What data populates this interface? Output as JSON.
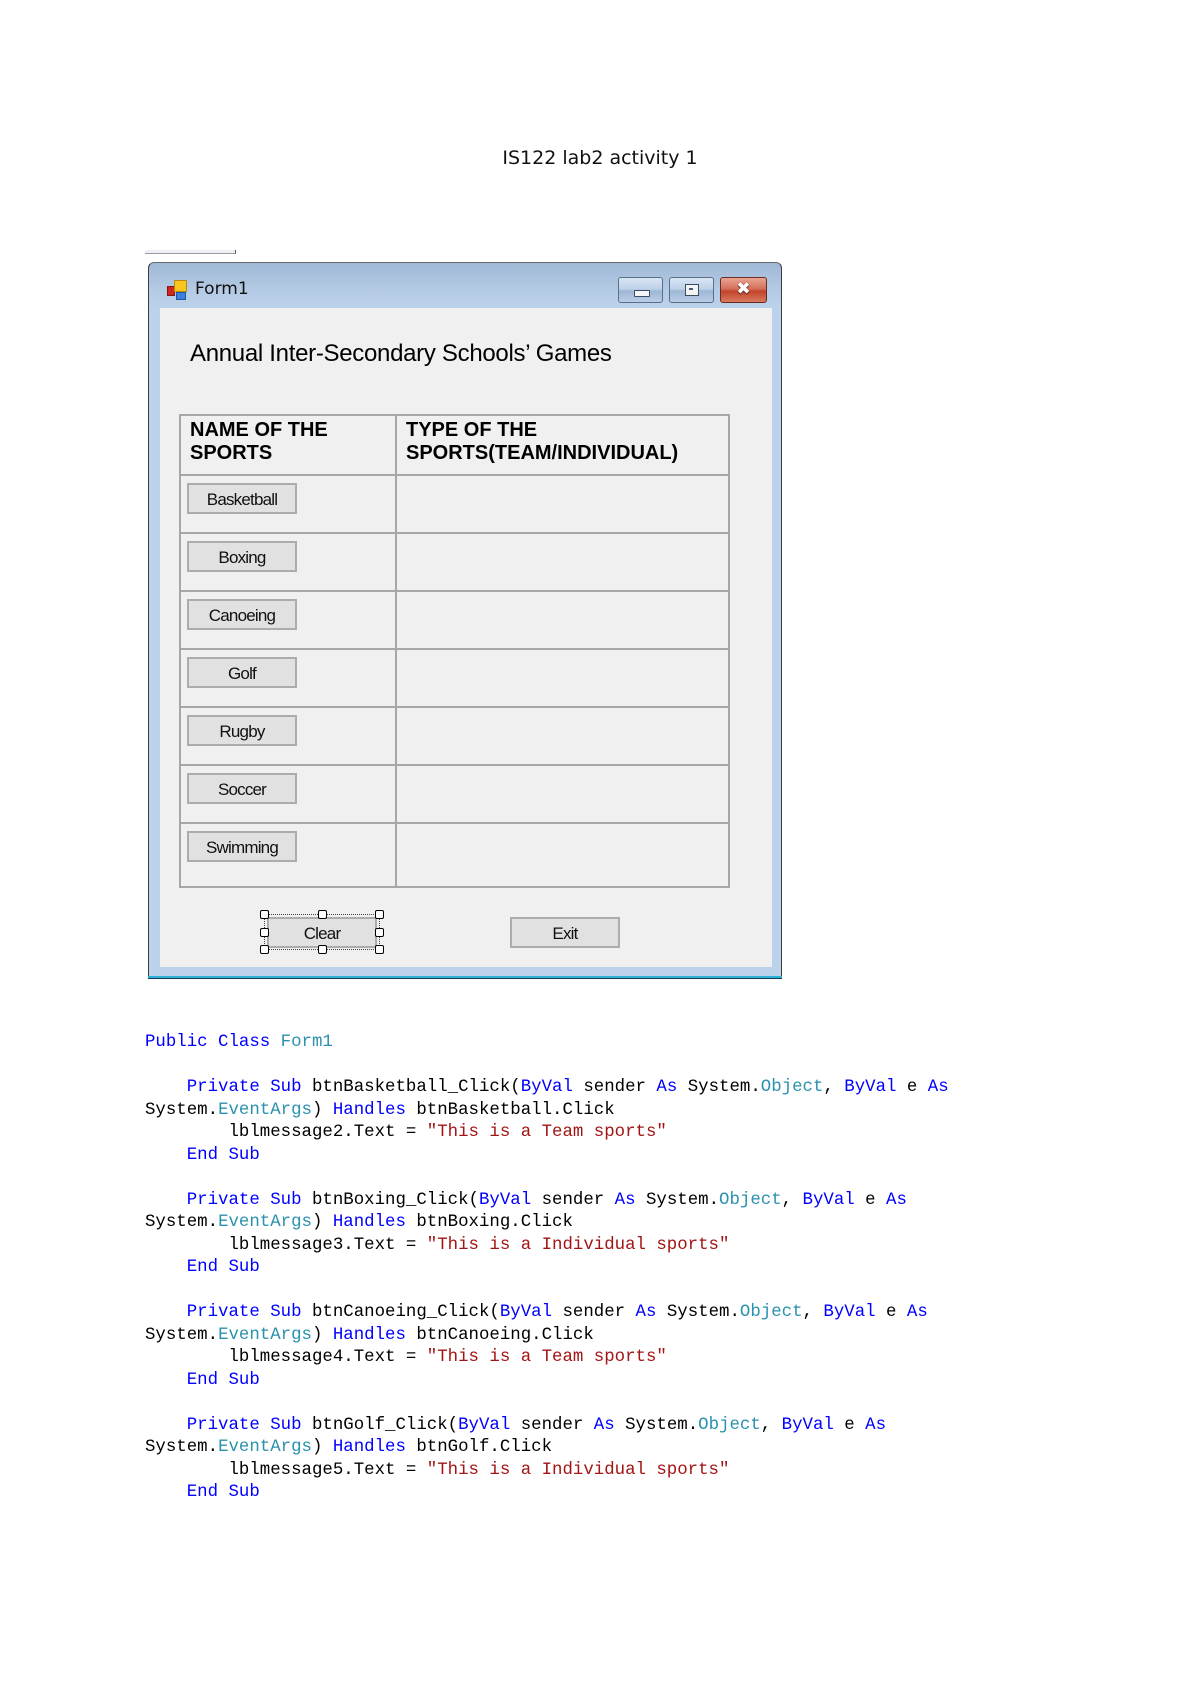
{
  "document": {
    "title": "IS122 lab2 activity 1"
  },
  "window": {
    "title": "Form1",
    "icon": "winforms-app-icon",
    "controls": {
      "minimize": "minimize-icon",
      "maximize": "maximize-icon",
      "close": "close-icon",
      "close_glyph": "✖"
    }
  },
  "form": {
    "heading": "Annual Inter-Secondary Schools’ Games",
    "table": {
      "headers": [
        "NAME OF THE SPORTS",
        "TYPE OF THE SPORTS(TEAM/INDIVIDUAL)"
      ],
      "rows": [
        {
          "sport": "Basketball",
          "type": ""
        },
        {
          "sport": "Boxing",
          "type": ""
        },
        {
          "sport": "Canoeing",
          "type": ""
        },
        {
          "sport": "Golf",
          "type": ""
        },
        {
          "sport": "Rugby",
          "type": ""
        },
        {
          "sport": "Soccer",
          "type": ""
        },
        {
          "sport": "Swimming",
          "type": ""
        }
      ]
    },
    "clear_label": "Clear",
    "exit_label": "Exit",
    "selected_control": "Clear"
  },
  "code": {
    "colors": {
      "keyword": "#0000ff",
      "type": "#2b91af",
      "string": "#a31515",
      "plain": "#000000"
    },
    "lines": [
      [
        [
          "kw",
          "Public Class "
        ],
        [
          "ty",
          "Form1"
        ]
      ],
      [],
      [
        [
          "",
          "    "
        ],
        [
          "kw",
          "Private Sub"
        ],
        [
          "",
          " btnBasketball_Click("
        ],
        [
          "kw",
          "ByVal"
        ],
        [
          "",
          " sender "
        ],
        [
          "kw",
          "As"
        ],
        [
          "",
          " System."
        ],
        [
          "ty",
          "Object"
        ],
        [
          "",
          ", "
        ],
        [
          "kw",
          "ByVal"
        ],
        [
          "",
          " e "
        ],
        [
          "kw",
          "As"
        ]
      ],
      [
        [
          "",
          "System."
        ],
        [
          "ty",
          "EventArgs"
        ],
        [
          "",
          ") "
        ],
        [
          "kw",
          "Handles"
        ],
        [
          "",
          " btnBasketball.Click"
        ]
      ],
      [
        [
          "",
          "        lblmessage2.Text = "
        ],
        [
          "str",
          "\"This is a Team sports\""
        ]
      ],
      [
        [
          "",
          "    "
        ],
        [
          "kw",
          "End Sub"
        ]
      ],
      [],
      [
        [
          "",
          "    "
        ],
        [
          "kw",
          "Private Sub"
        ],
        [
          "",
          " btnBoxing_Click("
        ],
        [
          "kw",
          "ByVal"
        ],
        [
          "",
          " sender "
        ],
        [
          "kw",
          "As"
        ],
        [
          "",
          " System."
        ],
        [
          "ty",
          "Object"
        ],
        [
          "",
          ", "
        ],
        [
          "kw",
          "ByVal"
        ],
        [
          "",
          " e "
        ],
        [
          "kw",
          "As"
        ]
      ],
      [
        [
          "",
          "System."
        ],
        [
          "ty",
          "EventArgs"
        ],
        [
          "",
          ") "
        ],
        [
          "kw",
          "Handles"
        ],
        [
          "",
          " btnBoxing.Click"
        ]
      ],
      [
        [
          "",
          "        lblmessage3.Text = "
        ],
        [
          "str",
          "\"This is a Individual sports\""
        ]
      ],
      [
        [
          "",
          "    "
        ],
        [
          "kw",
          "End Sub"
        ]
      ],
      [],
      [
        [
          "",
          "    "
        ],
        [
          "kw",
          "Private Sub"
        ],
        [
          "",
          " btnCanoeing_Click("
        ],
        [
          "kw",
          "ByVal"
        ],
        [
          "",
          " sender "
        ],
        [
          "kw",
          "As"
        ],
        [
          "",
          " System."
        ],
        [
          "ty",
          "Object"
        ],
        [
          "",
          ", "
        ],
        [
          "kw",
          "ByVal"
        ],
        [
          "",
          " e "
        ],
        [
          "kw",
          "As"
        ]
      ],
      [
        [
          "",
          "System."
        ],
        [
          "ty",
          "EventArgs"
        ],
        [
          "",
          ") "
        ],
        [
          "kw",
          "Handles"
        ],
        [
          "",
          " btnCanoeing.Click"
        ]
      ],
      [
        [
          "",
          "        lblmessage4.Text = "
        ],
        [
          "str",
          "\"This is a Team sports\""
        ]
      ],
      [
        [
          "",
          "    "
        ],
        [
          "kw",
          "End Sub"
        ]
      ],
      [],
      [
        [
          "",
          "    "
        ],
        [
          "kw",
          "Private Sub"
        ],
        [
          "",
          " btnGolf_Click("
        ],
        [
          "kw",
          "ByVal"
        ],
        [
          "",
          " sender "
        ],
        [
          "kw",
          "As"
        ],
        [
          "",
          " System."
        ],
        [
          "ty",
          "Object"
        ],
        [
          "",
          ", "
        ],
        [
          "kw",
          "ByVal"
        ],
        [
          "",
          " e "
        ],
        [
          "kw",
          "As"
        ]
      ],
      [
        [
          "",
          "System."
        ],
        [
          "ty",
          "EventArgs"
        ],
        [
          "",
          ") "
        ],
        [
          "kw",
          "Handles"
        ],
        [
          "",
          " btnGolf.Click"
        ]
      ],
      [
        [
          "",
          "        lblmessage5.Text = "
        ],
        [
          "str",
          "\"This is a Individual sports\""
        ]
      ],
      [
        [
          "",
          "    "
        ],
        [
          "kw",
          "End Sub"
        ]
      ]
    ]
  }
}
